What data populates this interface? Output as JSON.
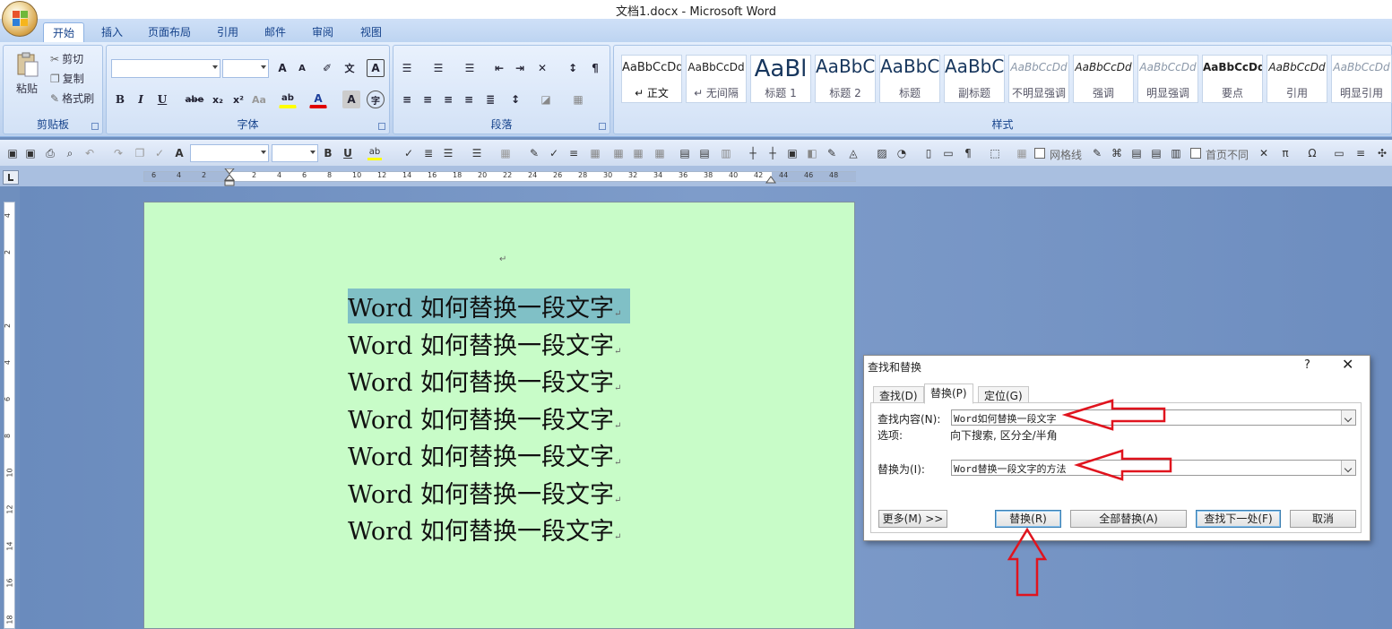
{
  "window": {
    "title": "文档1.docx - Microsoft Word"
  },
  "tabs": [
    "开始",
    "插入",
    "页面布局",
    "引用",
    "邮件",
    "审阅",
    "视图"
  ],
  "ribbon": {
    "clipboard": {
      "paste": "粘贴",
      "cut": "剪切",
      "copy": "复制",
      "format_painter": "格式刷",
      "label": "剪贴板"
    },
    "font": {
      "label": "字体",
      "grow": "A",
      "shrink": "A",
      "bold": "B",
      "italic": "I",
      "underline": "U",
      "strike": "abe",
      "subscript": "x₂",
      "superscript": "x²",
      "case": "Aa",
      "highlight": "ab",
      "color": "A",
      "char_border": "A",
      "enclose": "字"
    },
    "paragraph": {
      "label": "段落"
    },
    "styles": {
      "label": "样式",
      "items": [
        {
          "sample": "AaBbCcDd",
          "name": "↵ 正文"
        },
        {
          "sample": "AaBbCcDd",
          "name": "↵ 无间隔"
        },
        {
          "sample": "AaBl",
          "name": "标题 1"
        },
        {
          "sample": "AaBbC",
          "name": "标题 2"
        },
        {
          "sample": "AaBbC",
          "name": "标题"
        },
        {
          "sample": "AaBbC",
          "name": "副标题"
        },
        {
          "sample": "AaBbCcDd",
          "name": "不明显强调"
        },
        {
          "sample": "AaBbCcDd",
          "name": "强调"
        },
        {
          "sample": "AaBbCcDd",
          "name": "明显强调"
        },
        {
          "sample": "AaBbCcDd",
          "name": "要点"
        },
        {
          "sample": "AaBbCcDd",
          "name": "引用"
        },
        {
          "sample": "AaBbCcDd",
          "name": "明显引用"
        }
      ]
    }
  },
  "qat": {
    "bold": "B",
    "underline": "U",
    "gridlines": "网格线",
    "first_page_diff": "首页不同",
    "font_a": "A"
  },
  "ruler": {
    "h_ticks": [
      "6",
      "4",
      "2",
      "",
      "2",
      "4",
      "6",
      "8",
      "10",
      "12",
      "14",
      "16",
      "18",
      "20",
      "22",
      "24",
      "26",
      "28",
      "30",
      "32",
      "34",
      "36",
      "38",
      "40",
      "42",
      "44",
      "46",
      "48"
    ],
    "v_ticks": [
      "4",
      "2",
      "",
      "2",
      "4",
      "6",
      "8",
      "10",
      "12",
      "14",
      "16",
      "18"
    ]
  },
  "document": {
    "para_mark_top": "↵",
    "lines": [
      "Word 如何替换一段文字",
      "Word 如何替换一段文字",
      "Word 如何替换一段文字",
      "Word 如何替换一段文字",
      "Word 如何替换一段文字",
      "Word 如何替换一段文字",
      "Word 如何替换一段文字"
    ],
    "para_mark": "↵",
    "selection_color": "#80c0c6",
    "page_color": "#c8fcc8"
  },
  "dialog": {
    "title": "查找和替换",
    "help": "?",
    "close": "✕",
    "tabs": [
      "查找(D)",
      "替换(P)",
      "定位(G)"
    ],
    "find_label": "查找内容(N):",
    "find_value": "Word如何替换一段文字",
    "options_label": "选项:",
    "options_value": "向下搜索, 区分全/半角",
    "replace_label": "替换为(I):",
    "replace_value": "Word替换一段文字的方法",
    "more": "更多(M) >>",
    "replace": "替换(R)",
    "replace_all": "全部替换(A)",
    "find_next": "查找下一处(F)",
    "cancel": "取消"
  },
  "colors": {
    "annotation_arrow": "#e0141e"
  }
}
